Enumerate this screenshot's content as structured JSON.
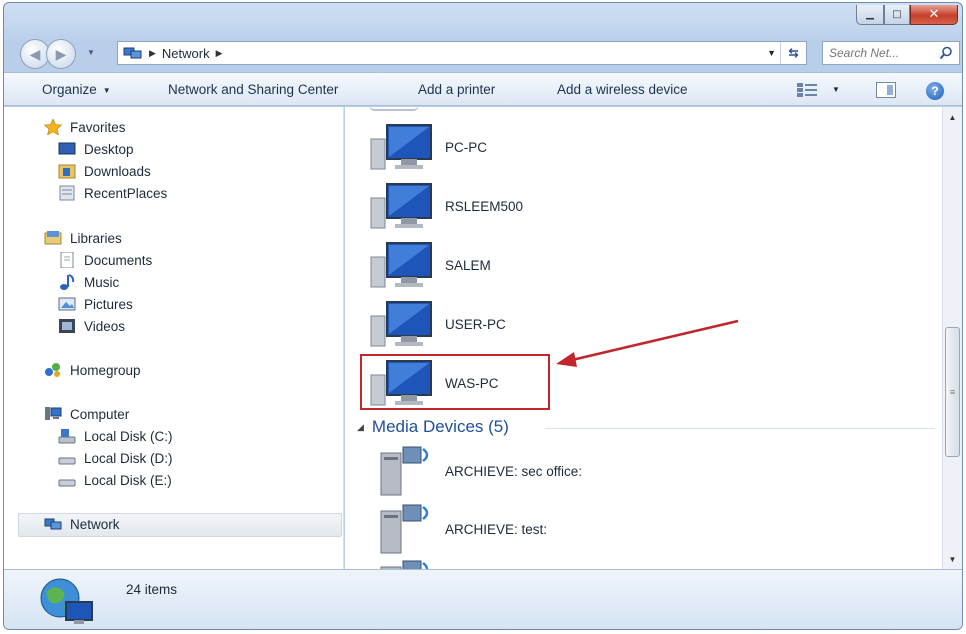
{
  "window": {
    "minimize": "▁",
    "maximize": "□",
    "close": "✕"
  },
  "address": {
    "crumb": "Network",
    "back": "◀",
    "forward": "▶"
  },
  "search": {
    "placeholder": "Search Net..."
  },
  "toolbar": {
    "organize": "Organize",
    "network_sharing": "Network and Sharing Center",
    "add_printer": "Add a printer",
    "add_wireless": "Add a wireless device",
    "help": "?"
  },
  "nav": {
    "favorites": "Favorites",
    "desktop": "Desktop",
    "downloads": "Downloads",
    "recent": "RecentPlaces",
    "libraries": "Libraries",
    "documents": "Documents",
    "music": "Music",
    "pictures": "Pictures",
    "videos": "Videos",
    "homegroup": "Homegroup",
    "computer": "Computer",
    "disk_c": "Local Disk (C:)",
    "disk_d": "Local Disk (D:)",
    "disk_e": "Local Disk (E:)",
    "network": "Network"
  },
  "computers": [
    "PC-PC",
    "RSLEEM500",
    "SALEM",
    "USER-PC",
    "WAS-PC"
  ],
  "media_header": "Media Devices (5)",
  "media": [
    "ARCHIEVE: sec office:",
    "ARCHIEVE: test:"
  ],
  "status": {
    "count": "24 items"
  },
  "colors": {
    "highlight": "#c0262c",
    "accent": "#1e4f9c"
  }
}
